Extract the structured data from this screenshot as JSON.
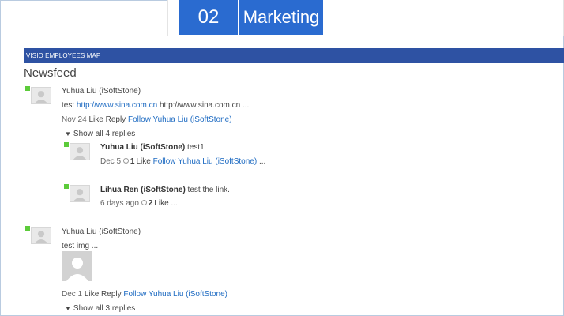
{
  "tiles": {
    "number": "02",
    "name": "Marketing"
  },
  "banner": {
    "text": "VISIO EMPLOYEES MAP"
  },
  "newsfeed": {
    "title": "Newsfeed",
    "post1": {
      "author": "Yuhua Liu (iSoftStone)",
      "text_prefix": "test ",
      "link": "http://www.sina.com.cn",
      "text_suffix": " http://www.sina.com.cn ...",
      "date": "Nov 24",
      "like": "Like",
      "reply": "Reply",
      "follow": "Follow Yuhua Liu (iSoftStone)",
      "show_replies": "Show all 4 replies"
    },
    "reply1": {
      "author": "Yuhua Liu (iSoftStone)",
      "text": " test1",
      "date": "Dec 5",
      "likes": "1",
      "like": "Like",
      "follow": "Follow Yuhua Liu (iSoftStone)",
      "more": "..."
    },
    "reply2": {
      "author": "Lihua Ren (iSoftStone)",
      "text": " test the link.",
      "date": "6 days ago",
      "likes": "2",
      "like": "Like",
      "more": "..."
    },
    "post2": {
      "author": "Yuhua Liu (iSoftStone)",
      "text": "test img ...",
      "date": "Dec 1",
      "like": "Like",
      "reply": "Reply",
      "follow": "Follow Yuhua Liu (iSoftStone)",
      "show_replies": "Show all 3 replies"
    }
  },
  "colors": {
    "tile": "#2a6bd0",
    "banner": "#2e52a3",
    "link": "#1e6bc2",
    "presence": "#5ccb3a"
  },
  "icons": {
    "avatar": "person-silhouette-icon",
    "presence": "presence-status-icon",
    "like": "like-icon",
    "expand": "chevron-down-icon"
  }
}
